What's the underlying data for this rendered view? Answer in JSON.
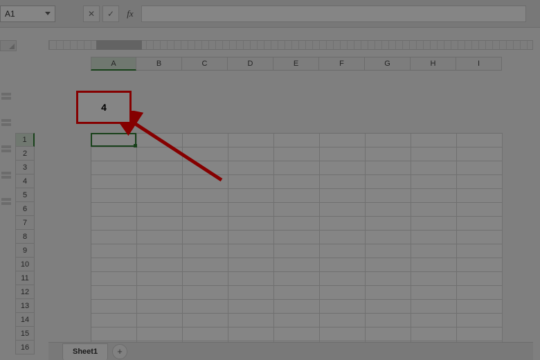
{
  "namebox": {
    "value": "A1"
  },
  "formula_bar": {
    "cancel_label": "✕",
    "confirm_label": "✓",
    "fx_label": "fx",
    "value": ""
  },
  "columns": [
    "A",
    "B",
    "C",
    "D",
    "E",
    "F",
    "G",
    "H",
    "I"
  ],
  "active_column": "A",
  "rows": [
    "1",
    "2",
    "3",
    "4",
    "5",
    "6",
    "7",
    "8",
    "9",
    "10",
    "11",
    "12",
    "13",
    "14",
    "15",
    "16"
  ],
  "active_row": "1",
  "selected_cell": "A1",
  "sheet_tabs": {
    "active": "Sheet1",
    "add_label": "+"
  },
  "callout": {
    "text": "4"
  },
  "colors": {
    "arrow": "#ff0000",
    "callout_border": "#ff0000",
    "selection": "#2e7d32"
  }
}
